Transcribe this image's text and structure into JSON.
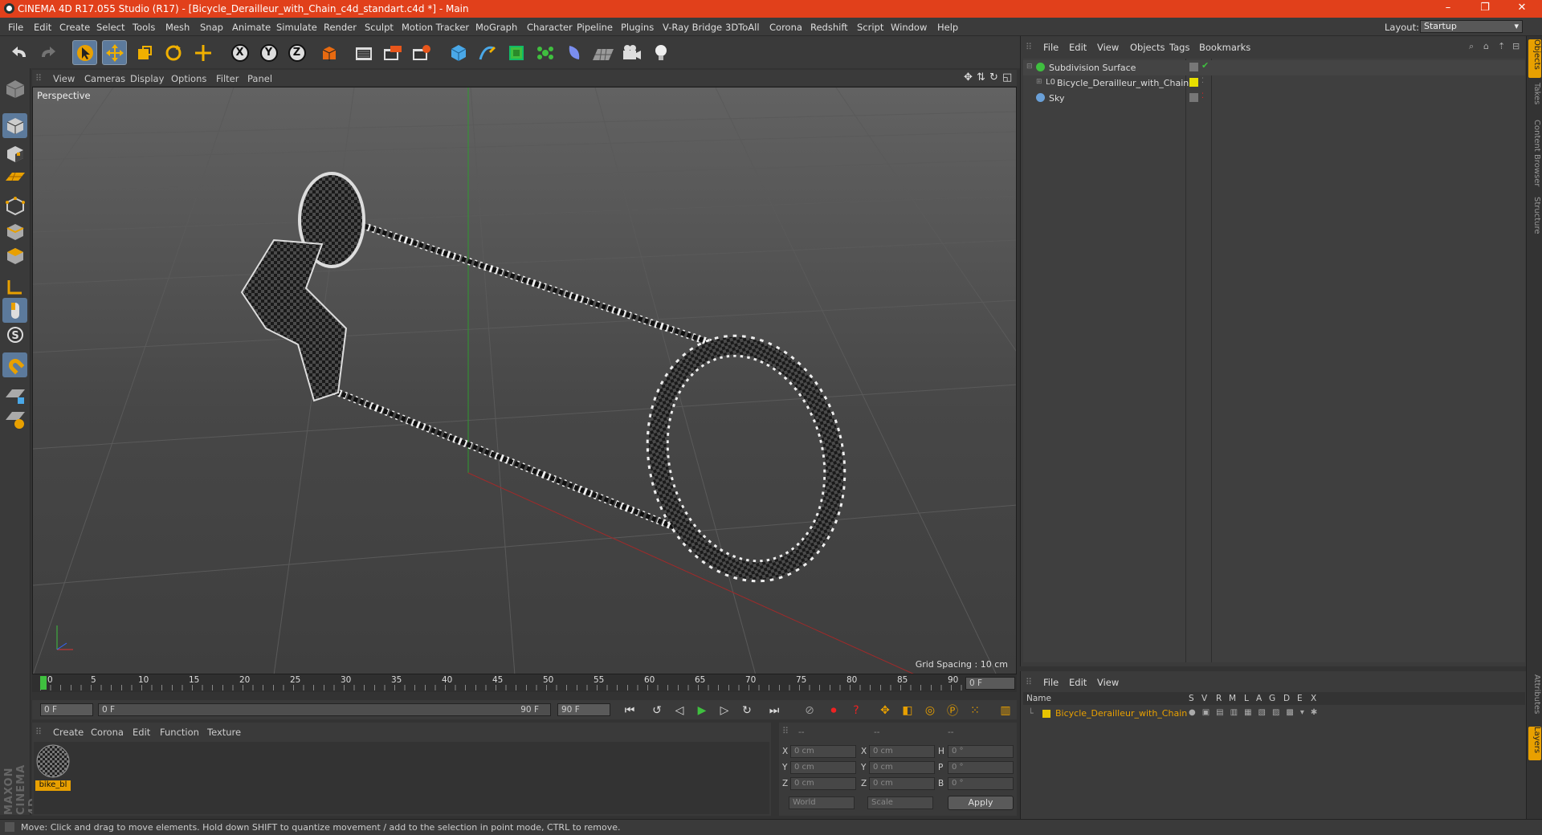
{
  "window": {
    "title": "CINEMA 4D R17.055 Studio (R17) - [Bicycle_Derailleur_with_Chain_c4d_standart.c4d *] - Main",
    "controls": [
      "–",
      "❐",
      "✕"
    ]
  },
  "menubar": {
    "items": [
      "File",
      "Edit",
      "Create",
      "Select",
      "Tools",
      "Mesh",
      "Snap",
      "Animate",
      "Simulate",
      "Render",
      "Sculpt",
      "Motion Tracker",
      "MoGraph",
      "Character",
      "Pipeline",
      "Plugins",
      "V-Ray Bridge",
      "3DToAll",
      "Corona",
      "Redshift",
      "Script",
      "Window",
      "Help"
    ],
    "layout_label": "Layout:",
    "layout_value": "Startup"
  },
  "main_toolbar": {
    "icons": [
      "undo-icon",
      "redo-icon",
      "select-arrow-icon",
      "move-icon",
      "scale-icon",
      "rotate-icon",
      "live-select-icon",
      "x-axis-icon",
      "y-axis-icon",
      "z-axis-icon",
      "coordinate-system-icon",
      "render-view-icon",
      "render-picture-viewer-icon",
      "edit-render-settings-icon",
      "cube-icon",
      "pen-spline-icon",
      "subdivision-icon",
      "mograph-cloner-icon",
      "deformer-icon",
      "floor-icon",
      "camera-icon",
      "light-icon"
    ],
    "axis_letters": [
      "X",
      "Y",
      "Z"
    ]
  },
  "left_toolbar": {
    "icons": [
      "make-editable-icon",
      "model-mode-icon",
      "texture-mode-icon",
      "workplane-icon",
      "points-mode-icon",
      "edges-mode-icon",
      "polygons-mode-icon",
      "uv-axis-icon",
      "tweak-mode-icon",
      "solo-icon",
      "magnet-icon",
      "snap-enable-icon",
      "snap-settings-icon"
    ]
  },
  "viewport": {
    "menu": [
      "View",
      "Cameras",
      "Display",
      "Options",
      "Filter",
      "Panel"
    ],
    "label": "Perspective",
    "grid_spacing": "Grid Spacing : 10 cm"
  },
  "timeline": {
    "ticks": [
      "0",
      "5",
      "10",
      "15",
      "20",
      "25",
      "30",
      "35",
      "40",
      "45",
      "50",
      "55",
      "60",
      "65",
      "70",
      "75",
      "80",
      "85",
      "90"
    ],
    "current_frame_field": "0 F"
  },
  "playbar": {
    "start_field": "0 F",
    "range_start": "0 F",
    "range_end": "90 F",
    "end_field": "90 F"
  },
  "material_manager": {
    "menu": [
      "Create",
      "Corona",
      "Edit",
      "Function",
      "Texture"
    ],
    "materials": [
      {
        "name": "bike_bl"
      }
    ]
  },
  "coordinates": {
    "header": [
      "--",
      "--",
      "--"
    ],
    "rows": [
      {
        "l1": "X",
        "v1": "0 cm",
        "l2": "X",
        "v2": "0 cm",
        "l3": "H",
        "v3": "0 °"
      },
      {
        "l1": "Y",
        "v1": "0 cm",
        "l2": "Y",
        "v2": "0 cm",
        "l3": "P",
        "v3": "0 °"
      },
      {
        "l1": "Z",
        "v1": "0 cm",
        "l2": "Z",
        "v2": "0 cm",
        "l3": "B",
        "v3": "0 °"
      }
    ],
    "dropdown1": "World",
    "dropdown2": "Scale",
    "apply": "Apply"
  },
  "object_manager": {
    "menu": [
      "File",
      "Edit",
      "View",
      "Objects",
      "Tags",
      "Bookmarks"
    ],
    "objects": [
      {
        "name": "Subdivision Surface"
      },
      {
        "name": "Bicycle_Derailleur_with_Chain"
      },
      {
        "name": "Sky"
      }
    ]
  },
  "layer_manager": {
    "menu": [
      "File",
      "Edit",
      "View"
    ],
    "columns": [
      "Name",
      "S",
      "V",
      "R",
      "M",
      "L",
      "A",
      "G",
      "D",
      "E",
      "X"
    ],
    "layers": [
      {
        "name": "Bicycle_Derailleur_with_Chain",
        "color": "#e8c400"
      }
    ]
  },
  "right_tabs": [
    "Objects",
    "Takes",
    "Content Browser",
    "Structure",
    "Attributes",
    "Layers"
  ],
  "status": "Move: Click and drag to move elements. Hold down SHIFT to quantize movement / add to the selection in point mode, CTRL to remove.",
  "brand": "MAXON CINEMA 4D",
  "colors": {
    "title_bar": "#e1401b",
    "accent": "#e8a000",
    "selected_button": "#5c7a9c"
  }
}
